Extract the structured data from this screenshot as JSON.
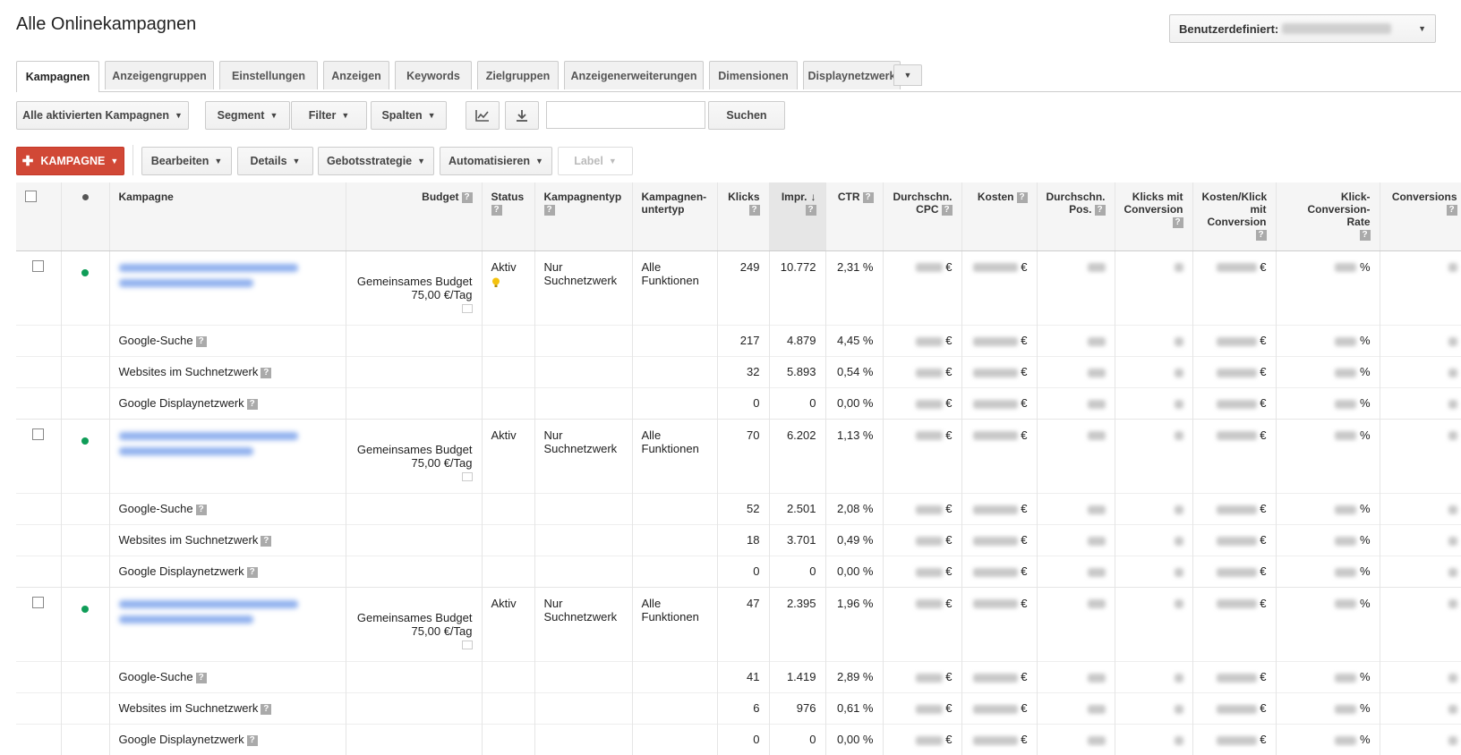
{
  "header": {
    "title": "Alle Onlinekampagnen",
    "date_label": "Benutzerdefiniert:"
  },
  "tabs": [
    {
      "label": "Kampagnen",
      "active": true
    },
    {
      "label": "Anzeigengruppen"
    },
    {
      "label": "Einstellungen"
    },
    {
      "label": "Anzeigen"
    },
    {
      "label": "Keywords"
    },
    {
      "label": "Zielgruppen"
    },
    {
      "label": "Anzeigenerweiterungen"
    },
    {
      "label": "Dimensionen"
    },
    {
      "label": "Displaynetzwerk"
    }
  ],
  "toolbar1": {
    "campaign_filter": "Alle aktivierten Kampagnen",
    "segment": "Segment",
    "filter": "Filter",
    "columns": "Spalten",
    "search_button": "Suchen",
    "search_value": ""
  },
  "toolbar2": {
    "add_campaign": "KAMPAGNE",
    "edit": "Bearbeiten",
    "details": "Details",
    "bid_strategy": "Gebotsstrategie",
    "automate": "Automatisieren",
    "label": "Label"
  },
  "columns": {
    "campaign": "Kampagne",
    "budget": "Budget",
    "status": "Status",
    "type": "Kampagnentyp",
    "subtype_1": "Kampagnen-",
    "subtype_2": "untertyp",
    "clicks": "Klicks",
    "impr": "Impr.",
    "ctr": "CTR",
    "cpc_1": "Durchschn.",
    "cpc_2": "CPC",
    "cost": "Kosten",
    "pos_1": "Durchschn.",
    "pos_2": "Pos.",
    "conv_clicks_1": "Klicks mit",
    "conv_clicks_2": "Conversion",
    "cost_conv_1": "Kosten/Klick",
    "cost_conv_2": "mit",
    "cost_conv_3": "Conversion",
    "conv_rate_1": "Klick-",
    "conv_rate_2": "Conversion-Rate",
    "conversions": "Conversions"
  },
  "campaigns": [
    {
      "budget_1": "Gemeinsames Budget",
      "budget_2": "75,00 €/Tag",
      "status": "Aktiv",
      "type_1": "Nur",
      "type_2": "Suchnetzwerk",
      "subtype_1": "Alle",
      "subtype_2": "Funktionen",
      "clicks": "249",
      "impr": "10.772",
      "ctr": "2,31 %",
      "currency": "€",
      "percent": "%",
      "subrows": [
        {
          "name": "Google-Suche",
          "clicks": "217",
          "impr": "4.879",
          "ctr": "4,45 %"
        },
        {
          "name": "Websites im Suchnetzwerk",
          "clicks": "32",
          "impr": "5.893",
          "ctr": "0,54 %"
        },
        {
          "name": "Google Displaynetzwerk",
          "clicks": "0",
          "impr": "0",
          "ctr": "0,00 %"
        }
      ]
    },
    {
      "budget_1": "Gemeinsames Budget",
      "budget_2": "75,00 €/Tag",
      "status": "Aktiv",
      "type_1": "Nur",
      "type_2": "Suchnetzwerk",
      "subtype_1": "Alle",
      "subtype_2": "Funktionen",
      "clicks": "70",
      "impr": "6.202",
      "ctr": "1,13 %",
      "currency": "€",
      "percent": "%",
      "subrows": [
        {
          "name": "Google-Suche",
          "clicks": "52",
          "impr": "2.501",
          "ctr": "2,08 %"
        },
        {
          "name": "Websites im Suchnetzwerk",
          "clicks": "18",
          "impr": "3.701",
          "ctr": "0,49 %"
        },
        {
          "name": "Google Displaynetzwerk",
          "clicks": "0",
          "impr": "0",
          "ctr": "0,00 %"
        }
      ]
    },
    {
      "budget_1": "Gemeinsames Budget",
      "budget_2": "75,00 €/Tag",
      "status": "Aktiv",
      "type_1": "Nur",
      "type_2": "Suchnetzwerk",
      "subtype_1": "Alle",
      "subtype_2": "Funktionen",
      "clicks": "47",
      "impr": "2.395",
      "ctr": "1,96 %",
      "currency": "€",
      "percent": "%",
      "subrows": [
        {
          "name": "Google-Suche",
          "clicks": "41",
          "impr": "1.419",
          "ctr": "2,89 %"
        },
        {
          "name": "Websites im Suchnetzwerk",
          "clicks": "6",
          "impr": "976",
          "ctr": "0,61 %"
        },
        {
          "name": "Google Displaynetzwerk",
          "clicks": "0",
          "impr": "0",
          "ctr": "0,00 %"
        }
      ]
    }
  ],
  "icons": {
    "add": "plus-icon",
    "chart": "line-chart-icon",
    "download": "download-icon",
    "help": "help-icon",
    "sort": "arrow-down-icon",
    "bulb": "lightbulb-icon",
    "dropdown": "caret-down-icon"
  },
  "colors": {
    "accent_red": "#d14836",
    "active_dot": "#0f9d58",
    "bulb": "#f4c20d",
    "blurred_link": "#8fb0ee"
  }
}
